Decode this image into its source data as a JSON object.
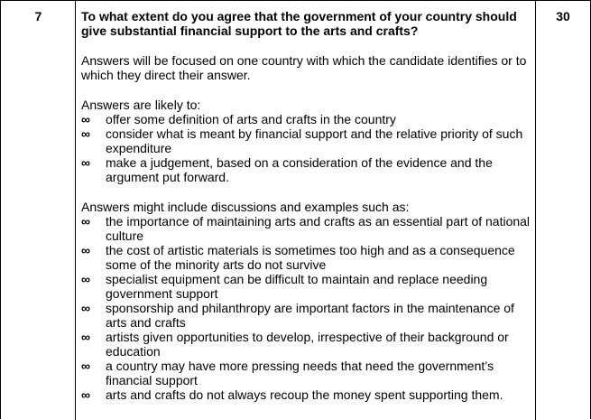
{
  "row": {
    "number": "7",
    "marks": "30",
    "question": "To what extent do you agree that the government of your country should give substantial financial support to the arts and crafts?",
    "intro": "Answers will be focused on one country with which the candidate identifies or to which they direct their answer.",
    "likely_heading": "Answers are likely to:",
    "likely_items": [
      "offer some definition of arts and crafts in the country",
      "consider what is meant by financial support and the relative priority of such expenditure",
      "make a judgement, based on a consideration of the evidence and the argument put forward."
    ],
    "examples_heading": "Answers might include discussions and examples such as:",
    "examples_items": [
      "the importance of maintaining arts and crafts as an essential part of national culture",
      "the cost of artistic materials is sometimes too high and as a consequence some of the minority arts do not survive",
      "specialist equipment can be difficult to maintain and replace needing government support",
      "sponsorship and philanthropy are important factors in the maintenance of arts and crafts",
      "artists given opportunities to develop, irrespective of their background or education",
      "a country may have more pressing needs that need the government’s financial support",
      "arts and crafts do not always recoup the money spent supporting them."
    ],
    "bullet_glyph": "∞"
  }
}
